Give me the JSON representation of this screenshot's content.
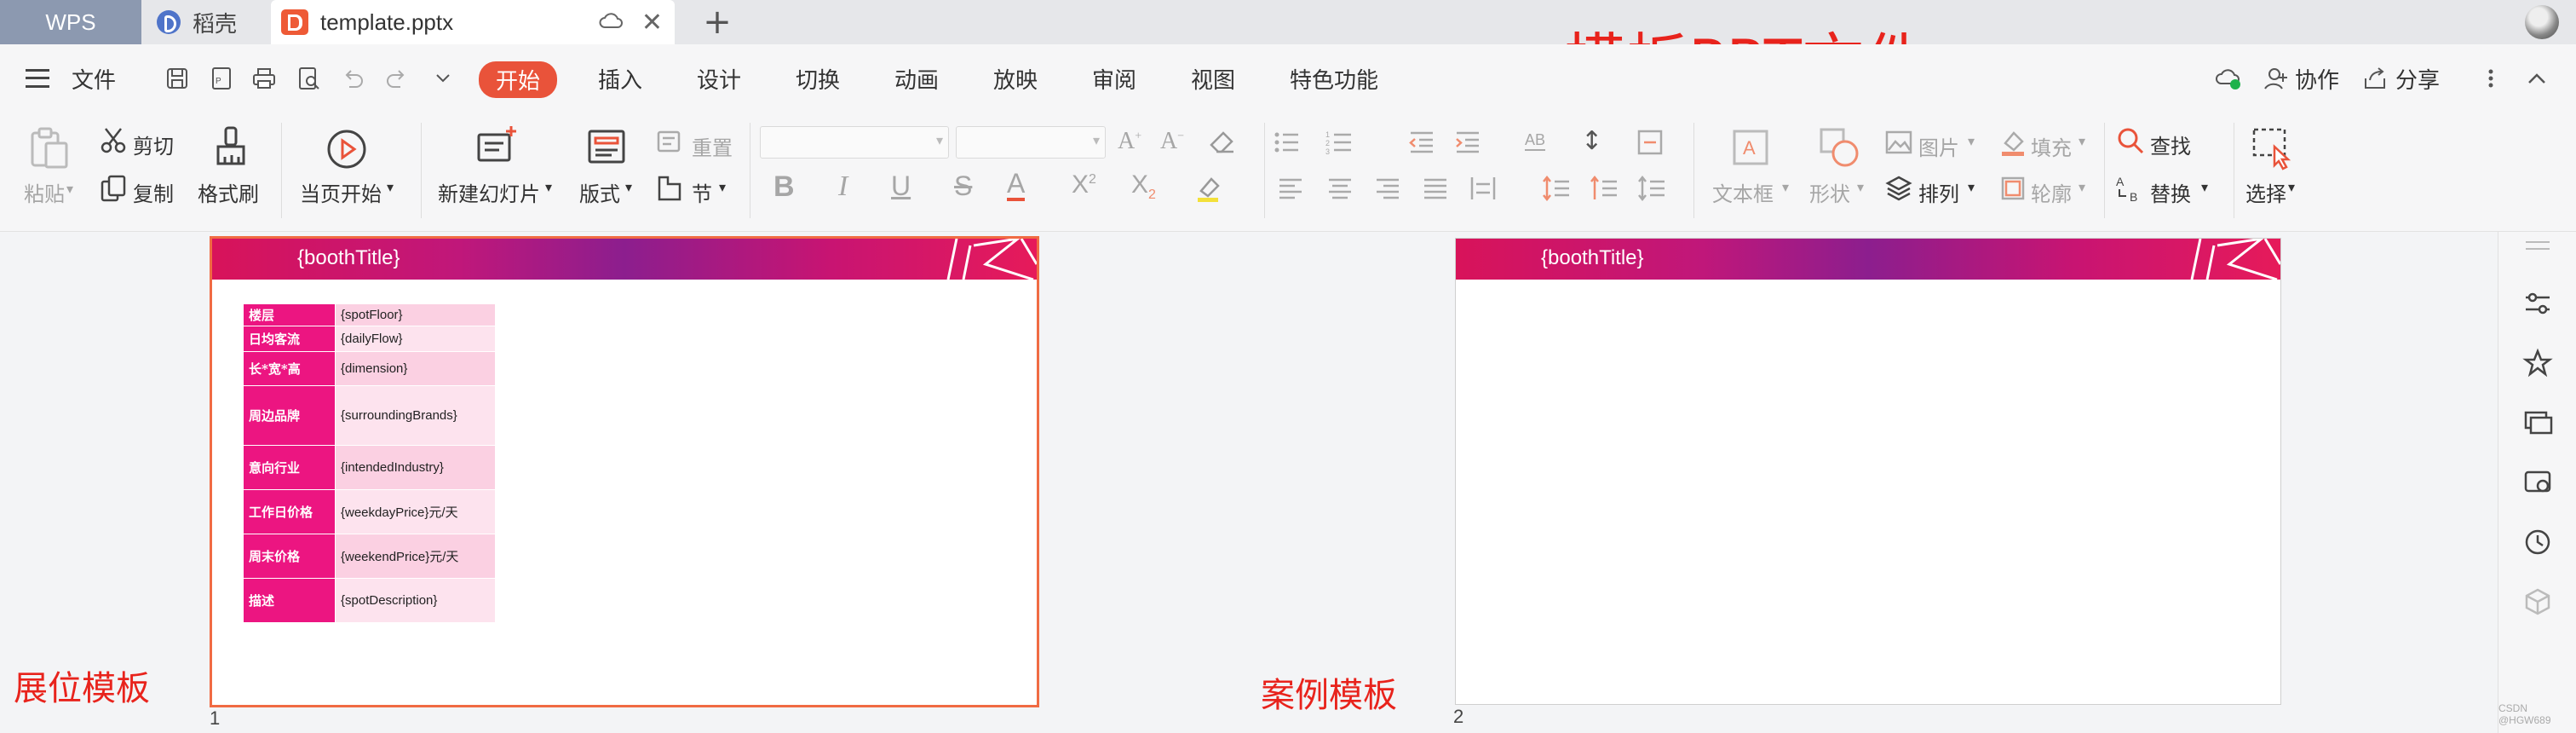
{
  "tabs": {
    "wps": "WPS",
    "daoke": "稻壳",
    "file": "template.pptx"
  },
  "annotations": {
    "top": "模板PPT文件",
    "left": "展位模板",
    "right": "案例模板"
  },
  "menu": {
    "file": "文件",
    "items": [
      "开始",
      "插入",
      "设计",
      "切换",
      "动画",
      "放映",
      "审阅",
      "视图",
      "特色功能"
    ],
    "collab": "协作",
    "share": "分享"
  },
  "ribbon": {
    "paste": "粘贴",
    "cut": "剪切",
    "copy": "复制",
    "format_painter": "格式刷",
    "from_current": "当页开始",
    "new_slide": "新建幻灯片",
    "layout": "版式",
    "reset": "重置",
    "section": "节",
    "textbox": "文本框",
    "shape": "形状",
    "picture": "图片",
    "arrange": "排列",
    "fill": "填充",
    "outline": "轮廓",
    "find": "查找",
    "replace": "替换",
    "select": "选择"
  },
  "slides": [
    {
      "number": "1",
      "title": "{boothTitle}",
      "rows": [
        {
          "key": "楼层",
          "value": "{spotFloor}"
        },
        {
          "key": "日均客流",
          "value": "{dailyFlow}"
        },
        {
          "key": "长*宽*高",
          "value": "{dimension}"
        },
        {
          "key": "周边品牌",
          "value": "{surroundingBrands}"
        },
        {
          "key": "意向行业",
          "value": "{intendedIndustry}"
        },
        {
          "key": "工作日价格",
          "value": "{weekdayPrice}元/天"
        },
        {
          "key": "周末价格",
          "value": "{weekendPrice}元/天"
        },
        {
          "key": "描述",
          "value": "{spotDescription}"
        }
      ]
    },
    {
      "number": "2",
      "title": "{boothTitle}"
    }
  ],
  "watermark": "CSDN @HGW689",
  "colors": {
    "accent": "#e9533a",
    "annotation": "#e8231c",
    "table_key": "#ec1581"
  }
}
